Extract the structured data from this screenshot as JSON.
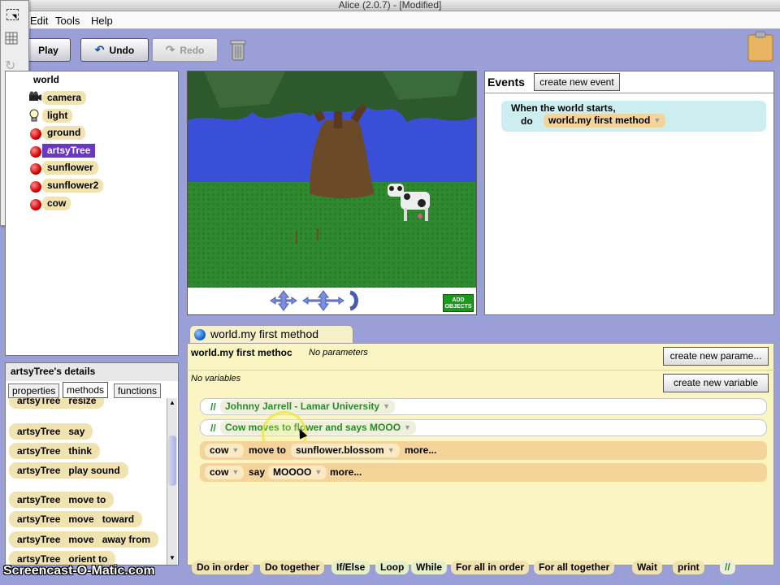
{
  "window": {
    "title": "Alice (2.0.7) -  [Modified]"
  },
  "menu": {
    "items": [
      "Edit",
      "Tools",
      "Help"
    ]
  },
  "toolbar": {
    "play": "Play",
    "undo": "Undo",
    "redo": "Redo"
  },
  "tree": {
    "nodes": [
      {
        "label": "world",
        "icon": "globe-icon"
      },
      {
        "label": "camera",
        "icon": "camera-icon"
      },
      {
        "label": "light",
        "icon": "lightbulb-icon"
      },
      {
        "label": "ground",
        "icon": "red-ball-icon"
      },
      {
        "label": "artsyTree",
        "icon": "red-ball-icon",
        "selected": true
      },
      {
        "label": "sunflower",
        "icon": "red-ball-icon"
      },
      {
        "label": "sunflower2",
        "icon": "red-ball-icon"
      },
      {
        "label": "cow",
        "icon": "red-ball-icon"
      }
    ]
  },
  "scene": {
    "add_objects_line1": "ADD",
    "add_objects_line2": "OBJECTS"
  },
  "events": {
    "title": "Events",
    "create_button": "create new event",
    "event_when": "When the world starts,",
    "event_do": "do",
    "event_method": "world.my first method"
  },
  "details": {
    "title": "artsyTree's details",
    "tabs": [
      "properties",
      "methods",
      "functions"
    ],
    "active_tab": "methods",
    "methods": [
      {
        "object": "artsyTree",
        "method": "resize"
      },
      {
        "object": "artsyTree",
        "method": "say"
      },
      {
        "object": "artsyTree",
        "method": "think"
      },
      {
        "object": "artsyTree",
        "method": "play sound"
      },
      {
        "object": "artsyTree",
        "method": "move to"
      },
      {
        "object": "artsyTree",
        "method": "move   toward"
      },
      {
        "object": "artsyTree",
        "method": "move   away from"
      },
      {
        "object": "artsyTree",
        "method": "orient to"
      }
    ]
  },
  "editor": {
    "tab_label": "world.my first method",
    "method_name": "world.my first methoc",
    "no_params": "No parameters",
    "create_param_button": "create new parame...",
    "no_vars": "No variables",
    "create_var_button": "create new variable",
    "comment_symbol": "//",
    "comments": [
      "Johnny Jarrell - Lamar University",
      "Cow moves to flower and says MOOO"
    ],
    "statements": [
      {
        "object": "cow",
        "verb": "move to",
        "arg": "sunflower.blossom",
        "more": "more..."
      },
      {
        "object": "cow",
        "verb": "say",
        "arg": "MOOOO",
        "more": "more..."
      }
    ]
  },
  "controls": [
    "Do in order",
    "Do together",
    "If/Else",
    "Loop",
    "While",
    "For all in order",
    "For all together",
    "Wait",
    "print",
    "//"
  ],
  "watermark": "Screencast-O-Matic.com"
}
